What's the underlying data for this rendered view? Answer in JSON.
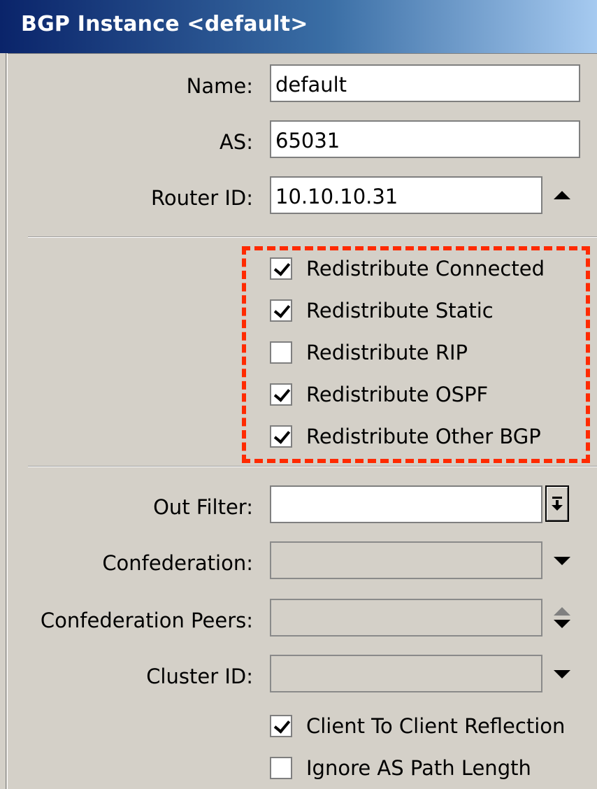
{
  "window": {
    "title": "BGP Instance <default>"
  },
  "fields": {
    "name": {
      "label": "Name:",
      "value": "default"
    },
    "as": {
      "label": "AS:",
      "value": "65031"
    },
    "router_id": {
      "label": "Router ID:",
      "value": "10.10.10.31"
    },
    "out_filter": {
      "label": "Out Filter:",
      "value": ""
    },
    "confederation": {
      "label": "Confederation:",
      "value": ""
    },
    "confederation_peers": {
      "label": "Confederation Peers:",
      "value": ""
    },
    "cluster_id": {
      "label": "Cluster ID:",
      "value": ""
    }
  },
  "redistribute": [
    {
      "label": "Redistribute Connected",
      "checked": true
    },
    {
      "label": "Redistribute Static",
      "checked": true
    },
    {
      "label": "Redistribute RIP",
      "checked": false
    },
    {
      "label": "Redistribute OSPF",
      "checked": true
    },
    {
      "label": "Redistribute Other BGP",
      "checked": true
    }
  ],
  "options": [
    {
      "label": "Client To Client Reflection",
      "checked": true
    },
    {
      "label": "Ignore AS Path Length",
      "checked": false
    }
  ],
  "colors": {
    "highlight": "#ff2a00",
    "title_gradient_start": "#0a246a",
    "title_gradient_end": "#a6caf0",
    "panel": "#d4d0c8"
  }
}
